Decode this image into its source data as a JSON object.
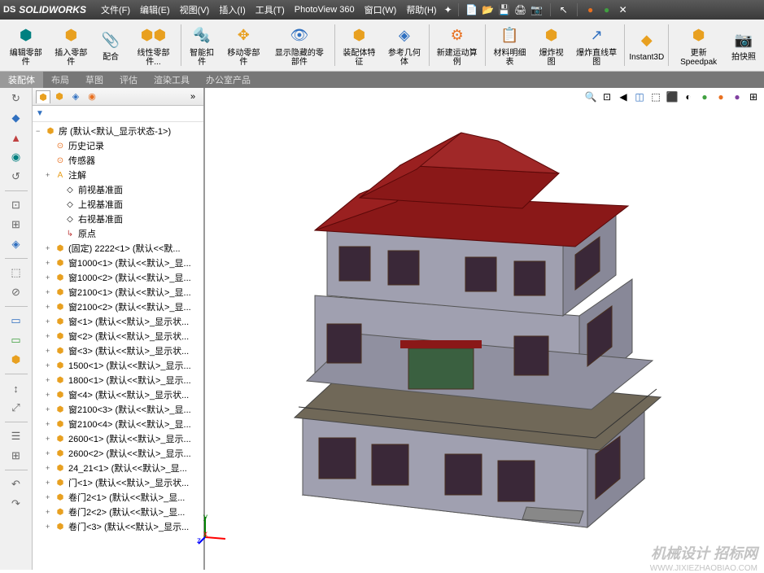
{
  "menubar": {
    "logo_prefix": "DS",
    "logo": "SOLIDWORKS",
    "items": [
      "文件(F)",
      "编辑(E)",
      "视图(V)",
      "插入(I)",
      "工具(T)",
      "PhotoView 360",
      "窗口(W)",
      "帮助(H)"
    ]
  },
  "ribbon": {
    "buttons": [
      {
        "label": "编辑零部件"
      },
      {
        "label": "插入零部件"
      },
      {
        "label": "配合"
      },
      {
        "label": "线性零部件..."
      },
      {
        "label": "智能扣件"
      },
      {
        "label": "移动零部件"
      },
      {
        "label": "显示隐藏的零部件"
      },
      {
        "label": "装配体特征"
      },
      {
        "label": "参考几何体"
      },
      {
        "label": "新建运动算例"
      },
      {
        "label": "材料明细表"
      },
      {
        "label": "爆炸视图"
      },
      {
        "label": "爆炸直线草图"
      },
      {
        "label": "Instant3D"
      },
      {
        "label": "更新Speedpak"
      },
      {
        "label": "拍快照"
      }
    ]
  },
  "tabs": [
    "装配体",
    "布局",
    "草图",
    "评估",
    "渲染工具",
    "办公室产品"
  ],
  "tree": {
    "root": "房 (默认<默认_显示状态-1>)",
    "system": [
      "历史记录",
      "传感器",
      "注解",
      "前视基准面",
      "上视基准面",
      "右视基准面",
      "原点"
    ],
    "parts": [
      "(固定) 2222<1> (默认<<默...",
      "窗1000<1> (默认<<默认>_显...",
      "窗1000<2> (默认<<默认>_显...",
      "窗2100<1> (默认<<默认>_显...",
      "窗2100<2> (默认<<默认>_显...",
      "窗<1> (默认<<默认>_显示状...",
      "窗<2> (默认<<默认>_显示状...",
      "窗<3> (默认<<默认>_显示状...",
      "1500<1> (默认<<默认>_显示...",
      "1800<1> (默认<<默认>_显示...",
      "窗<4> (默认<<默认>_显示状...",
      "窗2100<3> (默认<<默认>_显...",
      "窗2100<4> (默认<<默认>_显...",
      "2600<1> (默认<<默认>_显示...",
      "2600<2> (默认<<默认>_显示...",
      "24_21<1> (默认<<默认>_显...",
      "门<1> (默认<<默认>_显示状...",
      "卷门2<1> (默认<<默认>_显...",
      "卷门2<2> (默认<<默认>_显...",
      "卷门<3> (默认<<默认>_显示..."
    ]
  },
  "watermark": {
    "main": "机械设计 招标网",
    "sub": "WWW.JIXIEZHAOBIAO.COM"
  },
  "triad": {
    "x": "x",
    "y": "y",
    "z": "z"
  }
}
